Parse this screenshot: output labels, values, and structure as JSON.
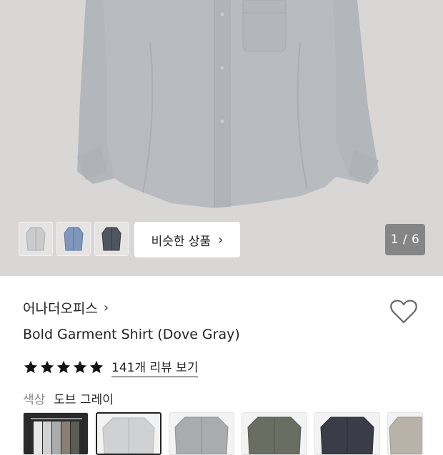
{
  "gallery": {
    "similar_button_label": "비슷한 상품",
    "similar_chevron": "›",
    "page_indicator": "1 / 6",
    "thumbnails": [
      {
        "name": "thumb-gray-shirt",
        "color": "#c9cbcd"
      },
      {
        "name": "thumb-blue-shirt",
        "color": "#7f97bd"
      },
      {
        "name": "thumb-navy-shirt",
        "color": "#4f5660"
      }
    ]
  },
  "product": {
    "brand": "어나더오피스",
    "brand_chevron": "›",
    "title": "Bold Garment Shirt (Dove Gray)",
    "rating_stars": 5,
    "reviews_link": "141개 리뷰 보기",
    "color_label": "색상",
    "color_value": "도브 그레이"
  },
  "swatches": [
    {
      "name": "swatch-all-colors",
      "color": "#2a2a2a",
      "selected": false
    },
    {
      "name": "swatch-dove-gray",
      "color": "#cfd1d3",
      "selected": true
    },
    {
      "name": "swatch-gray",
      "color": "#a9abad",
      "selected": false
    },
    {
      "name": "swatch-olive",
      "color": "#6a6d62",
      "selected": false
    },
    {
      "name": "swatch-navy",
      "color": "#3a3c48",
      "selected": false
    },
    {
      "name": "swatch-beige",
      "color": "#b8b2a8",
      "selected": false
    }
  ],
  "colors": {
    "hero_background": "#d9d7d6",
    "shirt": "#b8bcc0",
    "text_primary": "#222222",
    "text_muted": "#888888"
  }
}
